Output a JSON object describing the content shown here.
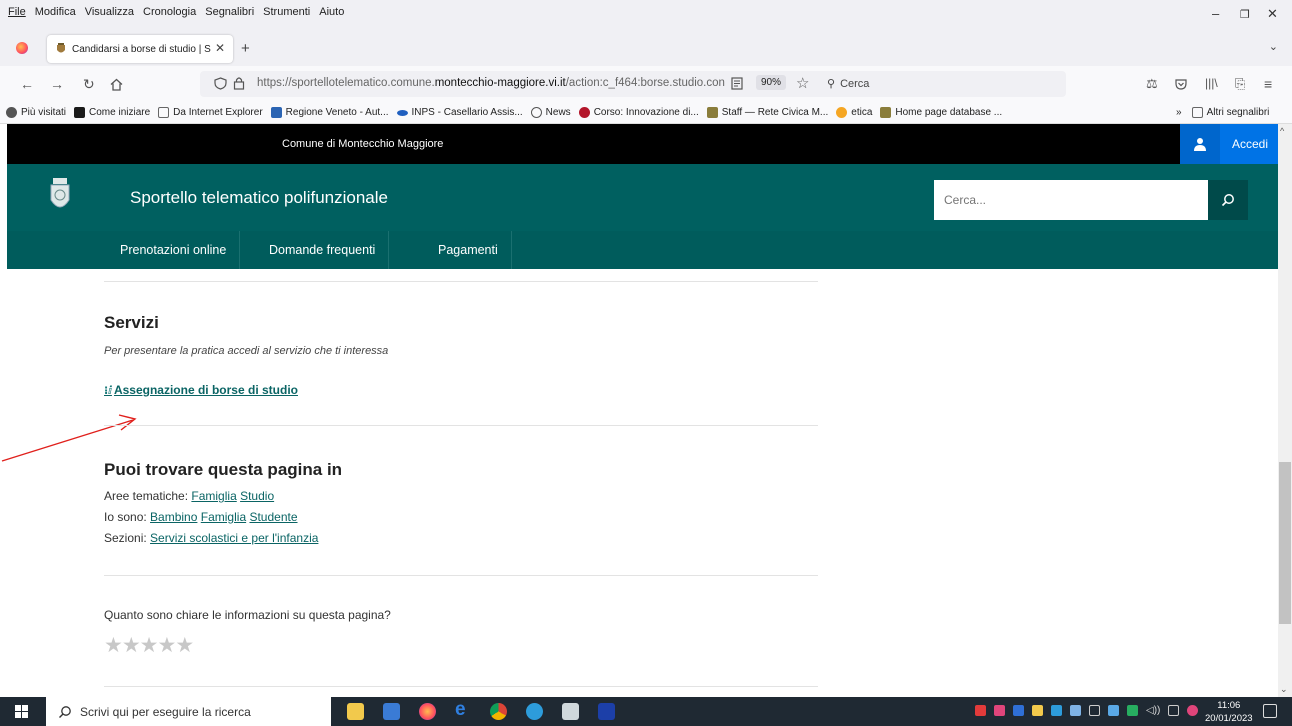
{
  "browser": {
    "menu": [
      "File",
      "Modifica",
      "Visualizza",
      "Cronologia",
      "Segnalibri",
      "Strumenti",
      "Aiuto"
    ],
    "tab_title": "Candidarsi a borse di studio | S",
    "url_prefix": "https://sportellotelematico.comune.",
    "url_domain": "montecchio-maggiore.vi.it",
    "url_path": "/action:c_f464:borse.studio.con",
    "zoom": "90%",
    "search_placeholder": "Cerca",
    "bookmarks": [
      {
        "label": "Più visitati",
        "color": "#555555"
      },
      {
        "label": "Come iniziare",
        "color": "#1a1a1a"
      },
      {
        "label": "Da Internet Explorer",
        "color": "#777777"
      },
      {
        "label": "Regione Veneto - Aut...",
        "color": "#2b64b3"
      },
      {
        "label": "INPS - Casellario Assis...",
        "color": "#1f5fbf"
      },
      {
        "label": "News",
        "color": "#555555"
      },
      {
        "label": "Corso: Innovazione di...",
        "color": "#b3152a"
      },
      {
        "label": "Staff — Rete Civica M...",
        "color": "#8a7d3b"
      },
      {
        "label": "etica",
        "color": "#f5a623"
      },
      {
        "label": "Home page database ...",
        "color": "#8a7d3b"
      }
    ],
    "other_bookmarks": "Altri segnalibri"
  },
  "site": {
    "municipality": "Comune di Montecchio Maggiore",
    "login_label": "Accedi",
    "title": "Sportello telematico polifunzionale",
    "search_placeholder": "Cerca...",
    "nav": [
      "Prenotazioni online",
      "Domande frequenti",
      "Pagamenti"
    ],
    "colors": {
      "header": "#006060",
      "nav": "#005c5c",
      "accent": "#0073e6",
      "link": "#0a6464"
    }
  },
  "main": {
    "services_heading": "Servizi",
    "services_sub": "Per presentare la pratica accedi al servizio che ti interessa",
    "service_link": "Assegnazione di borse di studio",
    "find_heading": "Puoi trovare questa pagina in",
    "aree_label": "Aree tematiche:",
    "aree": [
      "Famiglia",
      "Studio"
    ],
    "io_label": "Io sono:",
    "io": [
      "Bambino",
      "Famiglia",
      "Studente"
    ],
    "sezioni_label": "Sezioni:",
    "sezioni": [
      "Servizi scolastici e per l'infanzia"
    ],
    "feedback_question": "Quanto sono chiare le informazioni su questa pagina?",
    "rating": 0,
    "rating_max": 5
  },
  "taskbar": {
    "search_placeholder": "Scrivi qui per eseguire la ricerca",
    "time": "11:06",
    "date": "20/01/2023"
  }
}
